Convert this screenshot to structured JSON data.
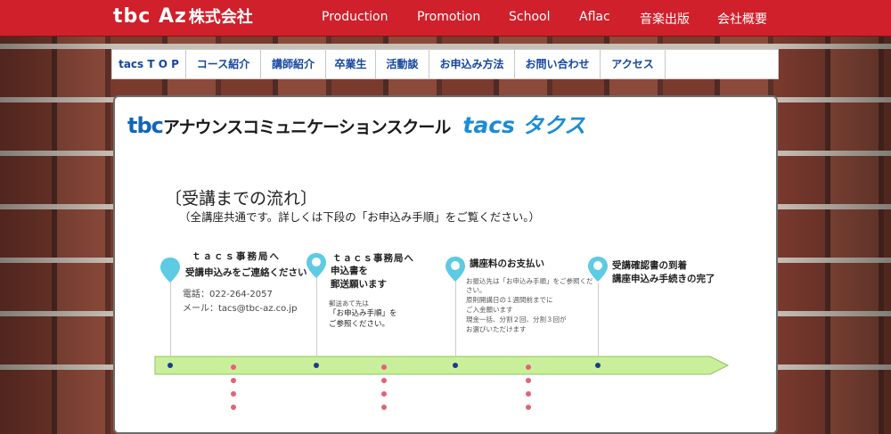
{
  "header": {
    "logo_text": "tbc Az",
    "logo_suffix": "株式会社",
    "nav": [
      "Production",
      "Promotion",
      "School",
      "Aflac",
      "音楽出版",
      "会社概要"
    ]
  },
  "subnav": {
    "items": [
      "tacs T O P",
      "コース紹介",
      "講師紹介",
      "卒業生",
      "活動談",
      "お申込み方法",
      "お問い合わせ",
      "アクセス"
    ]
  },
  "banner": {
    "tbc": "tbc",
    "school_name": "アナウンスコミュニケーションスクール",
    "tacs": "tacs",
    "takusu": "タクス"
  },
  "content": {
    "heading": "〔受講までの流れ〕",
    "subheading": "（全講座共通です。詳しくは下段の「お申込み手順」をご覧ください。）"
  },
  "steps": [
    {
      "title1": "ｔａｃｓ事務局へ",
      "title2": "受講申込みをご連絡ください",
      "phone": "電話：022-264-2057",
      "mail": "メール：tacs@tbc-az.co.jp"
    },
    {
      "title1": "ｔａｃｓ事務局へ",
      "title2": "申込書を",
      "title3": "郵送願います",
      "note1": "郵送あて先は",
      "note2": "「お申込み手順」を",
      "note3": "ご参照ください。"
    },
    {
      "title1": "講座料のお支払い",
      "note1": "お振込先は「お申込み手順」をご参照くだ",
      "note2": "さい。",
      "note3": "原則開講日の１週間前までに",
      "note4": "ご入金願います",
      "note5": "現金一括、分割２回、分割３回が",
      "note6": "お選びいただけます"
    },
    {
      "title1": "受講確認書の到着",
      "title2": "講座申込み手続きの完了"
    }
  ],
  "colors": {
    "header_red": "#d0202b",
    "nav_text_blue": "#1446a0",
    "pin_cyan": "#5ccbe3",
    "arrow_green": "#c9ef9b",
    "dot_blue": "#1a3c8a",
    "dot_red": "#e06478"
  },
  "icons": [
    "map-pin-icon",
    "map-pin-ring-icon"
  ]
}
